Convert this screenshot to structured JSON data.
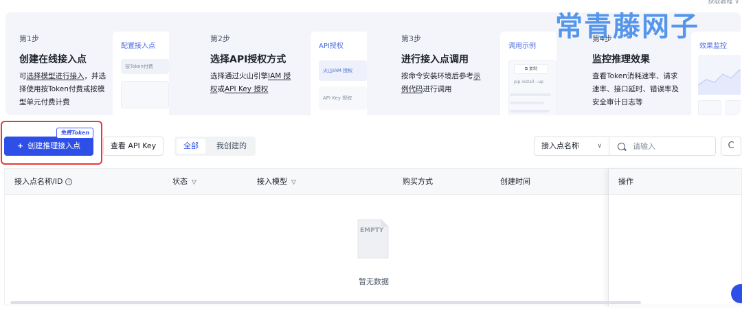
{
  "watermark": "常青藤网子",
  "top_right_link": "获取教程 ∨",
  "steps": [
    {
      "num": "第1步",
      "title": "创建在线接入点",
      "desc_parts": [
        "可",
        "选择模型进行接入",
        "，并选择使用按Token付费或按模型单元付费计费"
      ],
      "preview_title": "配置接入点",
      "preview_box": "按Token付费"
    },
    {
      "num": "第2步",
      "title": "选择API授权方式",
      "desc_parts": [
        "选择通过火山引擎",
        "IAM 授权",
        "或",
        "API Key 授权"
      ],
      "preview_title": "API授权",
      "preview_box": "火山IAM 授权",
      "preview_box2": "API Key 授权"
    },
    {
      "num": "第3步",
      "title": "进行接入点调用",
      "desc_parts": [
        "按命令安装环境后参考",
        "示例代码",
        "进行调用"
      ],
      "preview_title": "调用示例",
      "preview_box": "复制",
      "preview_code": "pip install --up"
    },
    {
      "num": "第4步",
      "title": "监控推理效果",
      "desc": "查看Token消耗速率、请求速率、接口延时、错误率及安全审计日志等",
      "preview_title": "效果监控"
    }
  ],
  "toolbar": {
    "free_badge": "免费Token",
    "create_plus": "+",
    "create_label": "创建推理接入点",
    "view_api_key": "查看 API Key",
    "filter_all": "全部",
    "filter_mine": "我创建的",
    "select_label": "接入点名称",
    "search_placeholder": "请输入",
    "refresh_icon": "C"
  },
  "table": {
    "columns": [
      {
        "label": "接入点名称/ID",
        "icon": "info-icon"
      },
      {
        "label": "状态",
        "icon": "filter-icon"
      },
      {
        "label": "接入模型",
        "icon": "filter-icon"
      },
      {
        "label": "购买方式"
      },
      {
        "label": "创建时间"
      },
      {
        "label": "操作"
      }
    ],
    "empty_illustration_text": "EMPTY",
    "empty_text": "暂无数据"
  },
  "colors": {
    "primary": "#2d4fe8",
    "highlight_frame": "#e53935",
    "watermark": "#2f7fe6"
  }
}
